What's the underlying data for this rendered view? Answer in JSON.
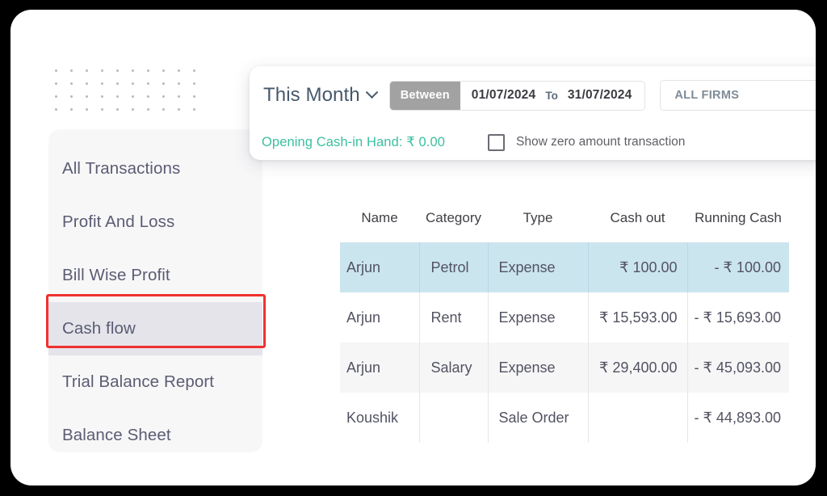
{
  "decor": {
    "dot_grid_icon": "dot-grid-icon",
    "dot_cols": 10,
    "dot_rows": 4
  },
  "sidebar": {
    "items": [
      {
        "label": "All Transactions",
        "active": false
      },
      {
        "label": "Profit And Loss",
        "active": false
      },
      {
        "label": "Bill Wise Profit",
        "active": false
      },
      {
        "label": "Cash flow",
        "active": true
      },
      {
        "label": "Trial Balance Report",
        "active": false
      },
      {
        "label": "Balance Sheet",
        "active": false
      }
    ]
  },
  "filters": {
    "period": {
      "value": "This Month",
      "chevron_icon": "chevron-down-icon"
    },
    "date_range": {
      "mode_label": "Between",
      "from": "01/07/2024",
      "separator": "To",
      "to": "31/07/2024"
    },
    "firm": {
      "value": "ALL FIRMS"
    },
    "opening_cash_label": "Opening Cash-in Hand: ₹ 0.00",
    "show_zero": {
      "label": "Show zero amount transaction",
      "checked": false
    }
  },
  "table": {
    "headers": [
      "Name",
      "Category",
      "Type",
      "Cash out",
      "Running Cash"
    ],
    "rows": [
      {
        "name": "Arjun",
        "category": "Petrol",
        "type": "Expense",
        "cash_out": "₹ 100.00",
        "running_cash": "- ₹ 100.00",
        "highlight": true
      },
      {
        "name": "Arjun",
        "category": "Rent",
        "type": "Expense",
        "cash_out": "₹ 15,593.00",
        "running_cash": "- ₹ 15,693.00",
        "highlight": false
      },
      {
        "name": "Arjun",
        "category": "Salary",
        "type": "Expense",
        "cash_out": "₹ 29,400.00",
        "running_cash": "- ₹ 45,093.00",
        "highlight": false
      },
      {
        "name": "Koushik",
        "category": "",
        "type": "Sale Order",
        "cash_out": "",
        "running_cash": "- ₹ 44,893.00",
        "highlight": false
      }
    ]
  },
  "colors": {
    "accent_teal": "#3bbfa0",
    "negative_red": "#e8847c",
    "row_highlight": "#cbe5ef",
    "annotation_red": "#f0312e",
    "badge_gray": "#a2a2a2",
    "sidebar_bg": "#f7f7f8",
    "sidebar_active_bg": "#e4e4ea"
  }
}
